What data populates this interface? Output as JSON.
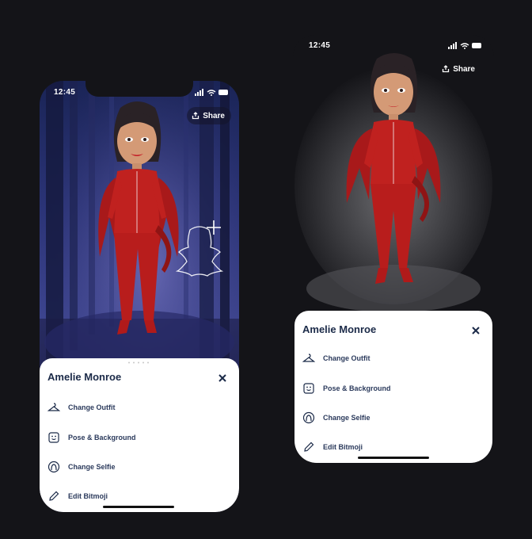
{
  "left_phone": {
    "status_time": "12:45",
    "share_label": "Share",
    "sheet": {
      "title": "Amelie Monroe",
      "items": [
        {
          "label": "Change Outfit",
          "icon": "hanger-icon"
        },
        {
          "label": "Pose & Background",
          "icon": "pose-background-icon"
        },
        {
          "label": "Change Selfie",
          "icon": "selfie-face-icon"
        },
        {
          "label": "Edit Bitmoji",
          "icon": "pencil-icon"
        }
      ]
    }
  },
  "right_phone": {
    "status_time": "12:45",
    "share_label": "Share",
    "sheet": {
      "title": "Amelie Monroe",
      "items": [
        {
          "label": "Change Outfit",
          "icon": "hanger-icon"
        },
        {
          "label": "Pose & Background",
          "icon": "pose-background-icon"
        },
        {
          "label": "Change Selfie",
          "icon": "selfie-face-icon"
        },
        {
          "label": "Edit Bitmoji",
          "icon": "pencil-icon"
        }
      ]
    }
  },
  "colors": {
    "page_bg": "#141418",
    "forest_blue": "#3d4590",
    "sheet_bg": "#ffffff",
    "text_dark": "#1b2a48",
    "devil_red": "#c0211f"
  }
}
